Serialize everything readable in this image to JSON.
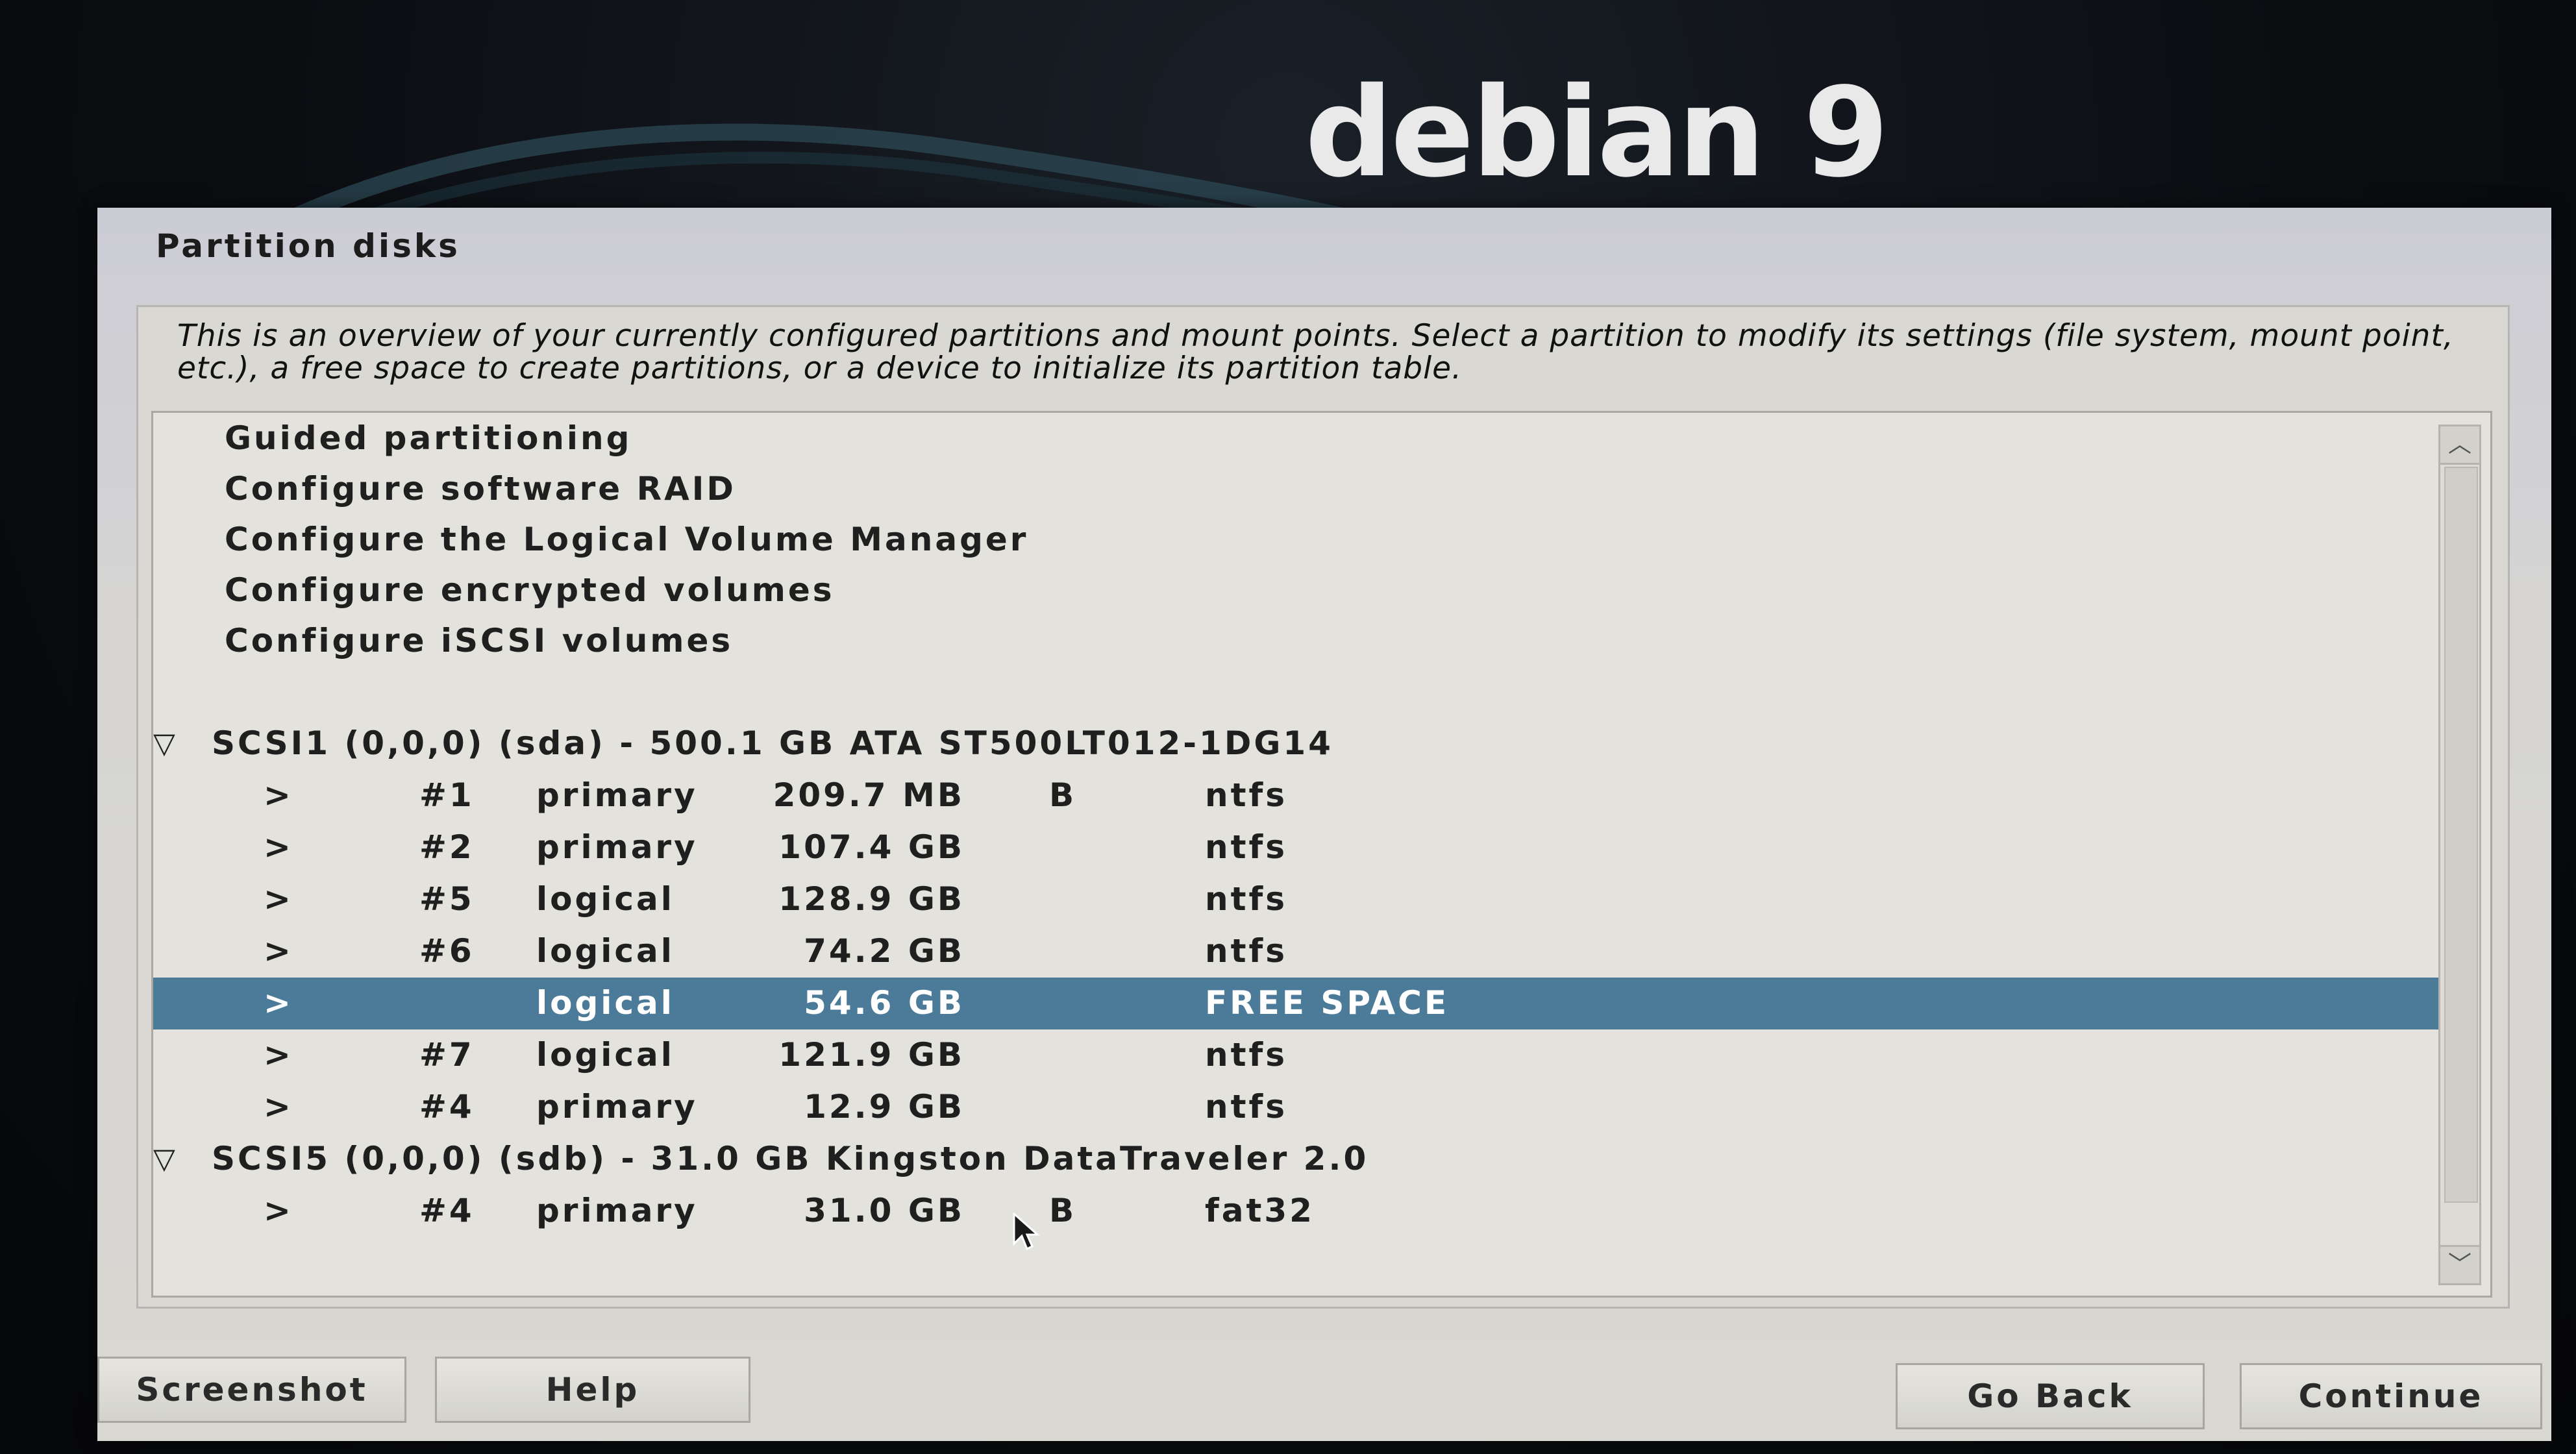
{
  "logo": {
    "text": "debian 9"
  },
  "dialog": {
    "title": "Partition disks",
    "description": "This is an overview of your currently configured partitions and mount points. Select a partition to modify its settings (file system, mount point, etc.), a free space to create partitions, or a device to initialize its partition table."
  },
  "menu": [
    {
      "label": "Guided partitioning"
    },
    {
      "label": "Configure software RAID"
    },
    {
      "label": "Configure the Logical Volume Manager"
    },
    {
      "label": "Configure encrypted volumes"
    },
    {
      "label": "Configure iSCSI volumes"
    }
  ],
  "disks": [
    {
      "toggle": "▽",
      "label": "SCSI1 (0,0,0) (sda) - 500.1 GB ATA ST500LT012-1DG14",
      "partitions": [
        {
          "arrow": ">",
          "num": "#1",
          "type": "primary",
          "size": "209.7 MB",
          "flag": "B",
          "fs": "ntfs"
        },
        {
          "arrow": ">",
          "num": "#2",
          "type": "primary",
          "size": "107.4 GB",
          "flag": "",
          "fs": "ntfs"
        },
        {
          "arrow": ">",
          "num": "#5",
          "type": "logical",
          "size": "128.9 GB",
          "flag": "",
          "fs": "ntfs"
        },
        {
          "arrow": ">",
          "num": "#6",
          "type": "logical",
          "size": "74.2 GB",
          "flag": "",
          "fs": "ntfs"
        },
        {
          "arrow": ">",
          "num": "",
          "type": "logical",
          "size": "54.6 GB",
          "flag": "",
          "fs": "FREE SPACE",
          "selected": true
        },
        {
          "arrow": ">",
          "num": "#7",
          "type": "logical",
          "size": "121.9 GB",
          "flag": "",
          "fs": "ntfs"
        },
        {
          "arrow": ">",
          "num": "#4",
          "type": "primary",
          "size": "12.9 GB",
          "flag": "",
          "fs": "ntfs"
        }
      ]
    },
    {
      "toggle": "▽",
      "label": "SCSI5 (0,0,0) (sdb) - 31.0 GB Kingston DataTraveler 2.0",
      "partitions": [
        {
          "arrow": ">",
          "num": "#4",
          "type": "primary",
          "size": "31.0 GB",
          "flag": "B",
          "fs": "fat32"
        }
      ]
    }
  ],
  "scrollbar": {
    "up_icon": "︿",
    "down_icon": "﹀"
  },
  "buttons": {
    "screenshot": "Screenshot",
    "help": "Help",
    "go_back": "Go Back",
    "continue": "Continue"
  },
  "colors": {
    "selection": "#4c7b9a",
    "dialog_bg": "#d9d7d1",
    "list_bg": "#e3e2dc"
  }
}
